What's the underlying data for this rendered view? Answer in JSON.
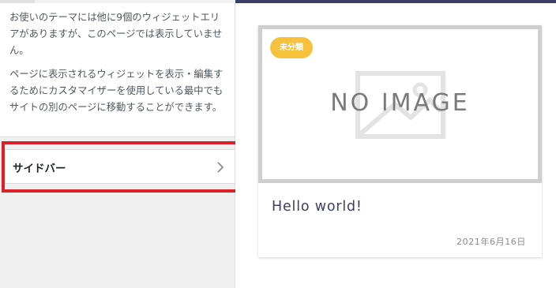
{
  "customizer": {
    "notice_paragraph_1": "お使いのテーマには他に9個のウィジェットエリアがありますが、このページでは表示していません。",
    "notice_paragraph_2": "ページに表示されるウィジェットを表示・編集するためにカスタマイザーを使用している最中でもサイトの別のページに移動することができます。",
    "section_label": "サイドバー",
    "highlight_color": "#d8232a"
  },
  "preview": {
    "accent_color": "#3a3f66",
    "post": {
      "category": "未分類",
      "category_color": "#f6c23e",
      "thumbnail_text": "NO IMAGE",
      "title": "Hello world!",
      "date": "2021年6月16日"
    }
  },
  "icons": {
    "section_arrow": "chevron-right-icon",
    "placeholder_image": "image-placeholder-icon"
  }
}
